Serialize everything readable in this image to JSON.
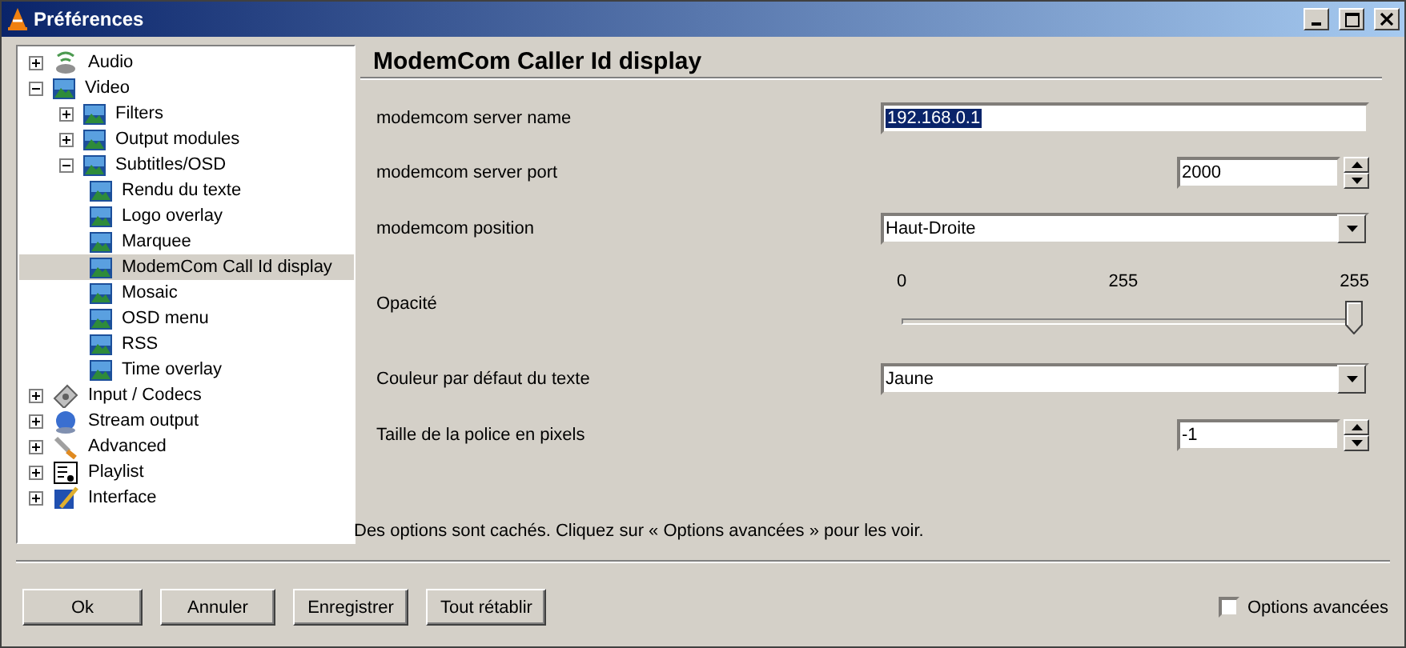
{
  "window": {
    "title": "Préférences"
  },
  "tree": [
    {
      "label": "Audio",
      "kind": "audio",
      "expanded": false,
      "selected": false
    },
    {
      "label": "Video",
      "kind": "video",
      "expanded": true,
      "selected": false,
      "children": [
        {
          "label": "Filters",
          "kind": "video",
          "expanded": false,
          "selected": false
        },
        {
          "label": "Output modules",
          "kind": "video",
          "expanded": false,
          "selected": false
        },
        {
          "label": "Subtitles/OSD",
          "kind": "video",
          "expanded": true,
          "selected": false,
          "children": [
            {
              "label": "Rendu du texte",
              "kind": "video",
              "selected": false
            },
            {
              "label": "Logo overlay",
              "kind": "video",
              "selected": false
            },
            {
              "label": "Marquee",
              "kind": "video",
              "selected": false
            },
            {
              "label": "ModemCom Call Id display",
              "kind": "video",
              "selected": true
            },
            {
              "label": "Mosaic",
              "kind": "video",
              "selected": false
            },
            {
              "label": "OSD menu",
              "kind": "video",
              "selected": false
            },
            {
              "label": "RSS",
              "kind": "video",
              "selected": false
            },
            {
              "label": "Time overlay",
              "kind": "video",
              "selected": false
            }
          ]
        }
      ]
    },
    {
      "label": "Input / Codecs",
      "kind": "input",
      "expanded": false,
      "selected": false
    },
    {
      "label": "Stream output",
      "kind": "stream",
      "expanded": false,
      "selected": false
    },
    {
      "label": "Advanced",
      "kind": "advanced",
      "expanded": false,
      "selected": false
    },
    {
      "label": "Playlist",
      "kind": "playlist",
      "expanded": false,
      "selected": false
    },
    {
      "label": "Interface",
      "kind": "interface",
      "expanded": false,
      "selected": false
    }
  ],
  "panel": {
    "title": "ModemCom Caller Id display",
    "settings": [
      {
        "kind": "text",
        "label": "modemcom server name",
        "value": "192.168.0.1"
      },
      {
        "kind": "spin",
        "label": "modemcom server port",
        "value": "2000"
      },
      {
        "kind": "select",
        "label": "modemcom position",
        "value": "Haut-Droite"
      },
      {
        "kind": "slider",
        "label": "Opacité",
        "min": "0",
        "mid": "255",
        "max": "255",
        "level": 1
      },
      {
        "kind": "select",
        "label": "Couleur par défaut du texte",
        "value": "Jaune"
      },
      {
        "kind": "spin",
        "label": "Taille de la police en pixels",
        "value": "-1"
      }
    ],
    "hint": "Des options sont cachés. Cliquez sur « Options avancées » pour les voir."
  },
  "buttons": [
    "Ok",
    "Annuler",
    "Enregistrer",
    "Tout rétablir"
  ],
  "advanced_options": {
    "label": "Options avancées",
    "checked": false
  }
}
